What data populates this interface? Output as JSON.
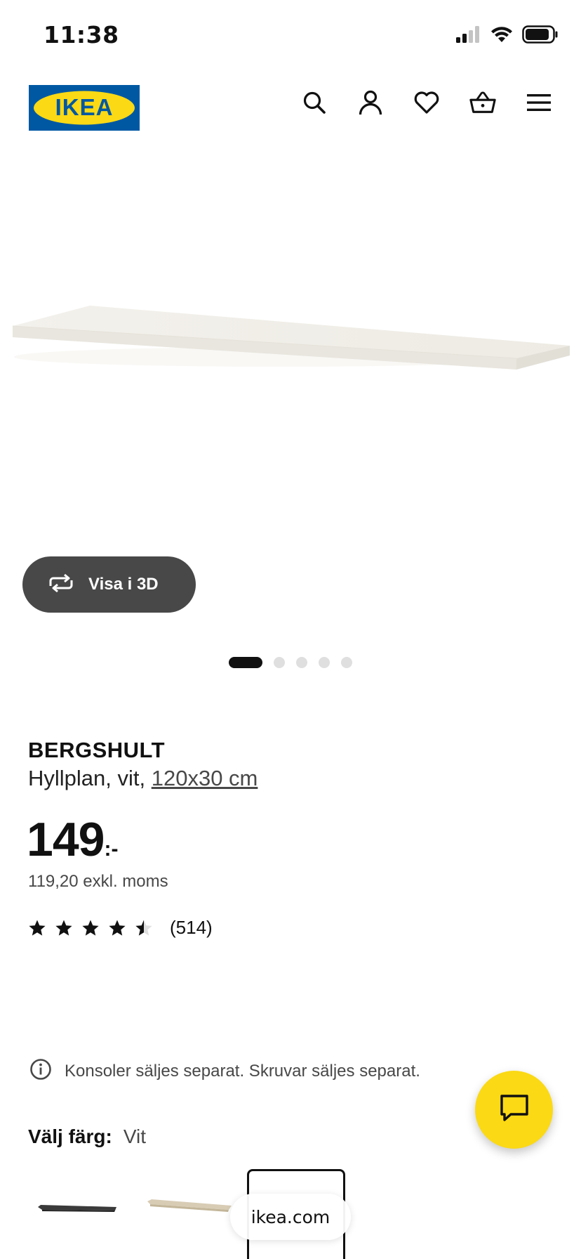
{
  "status_bar": {
    "time": "11:38",
    "icons": [
      "signal-icon",
      "wifi-icon",
      "battery-icon"
    ]
  },
  "header": {
    "logo_text": "IKEA",
    "icons": [
      "search-icon",
      "account-icon",
      "heart-icon",
      "cart-icon",
      "menu-icon"
    ]
  },
  "gallery": {
    "view_3d_label": "Visa i 3D",
    "slide_count": 5,
    "active_slide": 1
  },
  "product": {
    "name": "BERGSHULT",
    "description": "Hyllplan, vit, ",
    "size": "120x30 cm",
    "price": "149",
    "price_suffix": ":-",
    "price_excl": "119,20 exkl. moms",
    "rating": 4.5,
    "rating_count": "(514)"
  },
  "notice": {
    "text": "Konsoler säljes separat. Skruvar säljes separat."
  },
  "color_selector": {
    "label": "Välj färg:",
    "value": "Vit",
    "options": [
      {
        "name": "black-brown",
        "color": "#3a3a3a"
      },
      {
        "name": "white-stained-oak",
        "color": "#d8ccb5"
      },
      {
        "name": "white",
        "color": "#f1f0ec"
      }
    ],
    "selected_index": 2
  },
  "browser": {
    "url": "ikea.com"
  },
  "colors": {
    "ikea_blue": "#0058a3",
    "ikea_yellow": "#fbd914",
    "button_dark": "#484848"
  }
}
